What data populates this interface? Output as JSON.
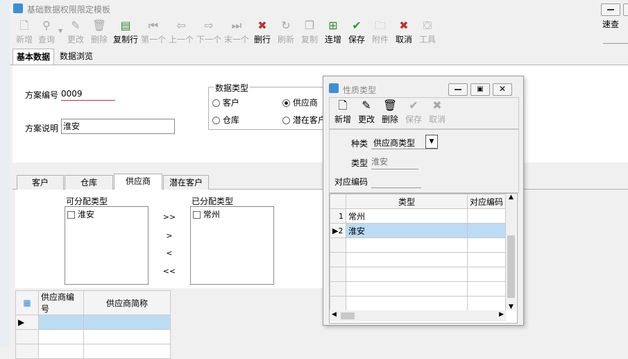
{
  "window": {
    "title": "基础数据权限限定模板",
    "right_text": "速查"
  },
  "toolbar": {
    "buttons": [
      {
        "label": "新增",
        "icon": "new-doc-icon",
        "enabled": false
      },
      {
        "label": "查询",
        "icon": "search-icon",
        "enabled": false
      },
      {
        "label": "更改",
        "icon": "pencil-icon",
        "enabled": false
      },
      {
        "label": "删除",
        "icon": "trash-icon",
        "enabled": false
      },
      {
        "label": "复制行",
        "icon": "copy-row-icon",
        "enabled": true
      },
      {
        "label": "第一个",
        "icon": "first-icon",
        "enabled": false
      },
      {
        "label": "上一个",
        "icon": "prev-icon",
        "enabled": false
      },
      {
        "label": "下一个",
        "icon": "next-icon",
        "enabled": false
      },
      {
        "label": "末一个",
        "icon": "last-icon",
        "enabled": false
      },
      {
        "label": "删行",
        "icon": "delete-row-icon",
        "enabled": true
      },
      {
        "label": "刷新",
        "icon": "refresh-icon",
        "enabled": false
      },
      {
        "label": "复制",
        "icon": "copy-icon",
        "enabled": false
      },
      {
        "label": "连增",
        "icon": "continuous-add-icon",
        "enabled": true
      },
      {
        "label": "保存",
        "icon": "check-icon",
        "enabled": true
      },
      {
        "label": "附件",
        "icon": "folder-icon",
        "enabled": false
      },
      {
        "label": "取消",
        "icon": "cancel-x-icon",
        "enabled": true
      },
      {
        "label": "工具",
        "icon": "toolbox-icon",
        "enabled": false
      }
    ]
  },
  "tabs": [
    "基本数据",
    "数据浏览"
  ],
  "form": {
    "scheme_no_label": "方案编号",
    "scheme_no_value": "0009",
    "scheme_desc_label": "方案说明",
    "scheme_desc_value": "淮安",
    "data_type_group": "数据类型",
    "radios": [
      "客户",
      "供应商",
      "仓库",
      "潜在客户"
    ],
    "selected": "供应商"
  },
  "lower_tabs": [
    "客户",
    "仓库",
    "供应商",
    "潜在客户"
  ],
  "assign": {
    "available_label": "可分配类型",
    "available_items": [
      "淮安"
    ],
    "assigned_label": "已分配类型",
    "assigned_items": [
      "常州"
    ],
    "arrows": [
      ">>",
      ">",
      "<",
      "<<"
    ]
  },
  "supplier_grid": {
    "headers": [
      "供应商编号",
      "供应商简称"
    ]
  },
  "dialog": {
    "title": "性质类型",
    "buttons": [
      {
        "label": "新增",
        "enabled": true
      },
      {
        "label": "更改",
        "enabled": true
      },
      {
        "label": "删除",
        "enabled": true
      },
      {
        "label": "保存",
        "enabled": false
      },
      {
        "label": "取消",
        "enabled": false
      }
    ],
    "kind_label": "种类",
    "kind_value": "供应商类型",
    "type_label": "类型",
    "type_value": "淮安",
    "code_label": "对应编码",
    "code_value": "",
    "grid_headers": [
      "类型",
      "对应编码"
    ],
    "rows": [
      {
        "no": "1",
        "type": "常州"
      },
      {
        "no": "2",
        "type": "淮安"
      }
    ]
  },
  "colors": {
    "selection": "#bcdcf4",
    "required_underline": "#c03030",
    "accent": "#3c8ed6"
  }
}
